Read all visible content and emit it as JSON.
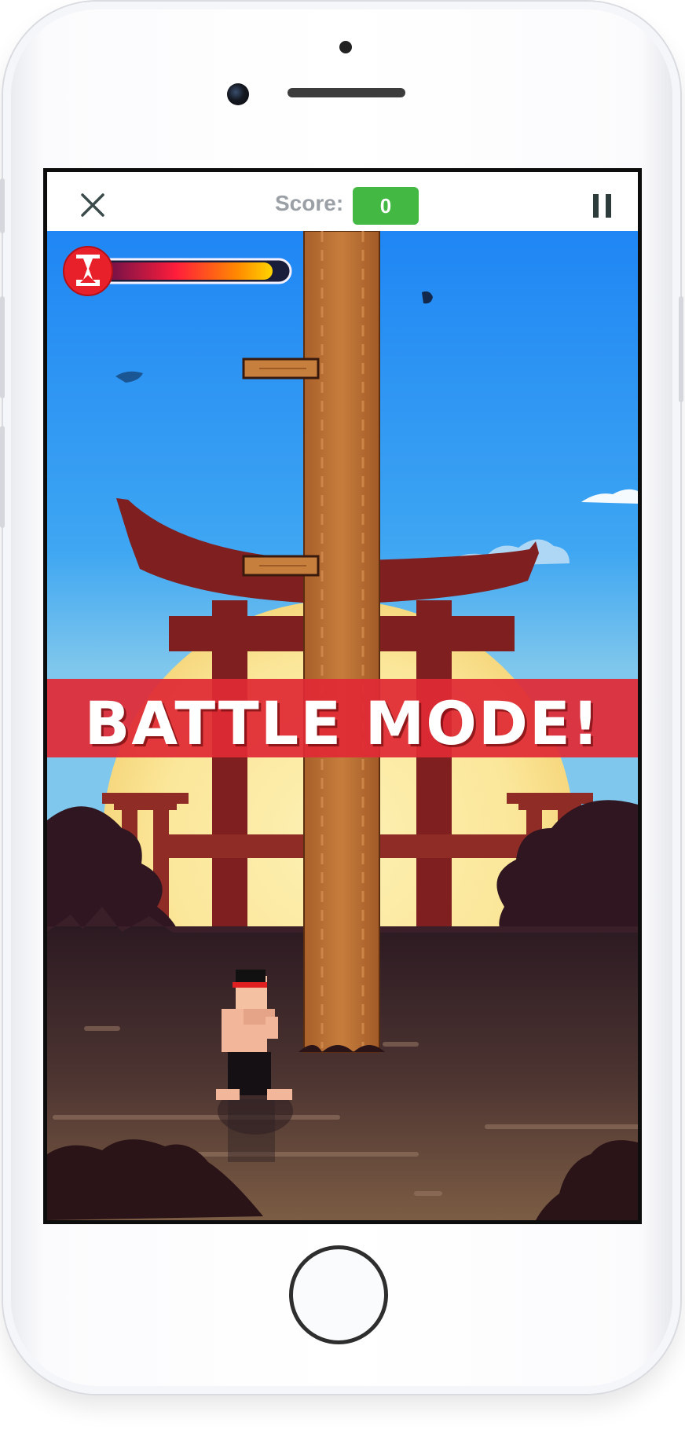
{
  "topbar": {
    "score_label": "Score:",
    "score_value": "0",
    "close_icon": "close-x",
    "pause_icon": "pause"
  },
  "game": {
    "banner_text": "BATTLE MODE!",
    "timer_icon": "hourglass",
    "timer_level": 0.92
  },
  "colors": {
    "score_badge": "#43b843",
    "banner": "#e02a35",
    "sky": "#2a8df0",
    "sun": "#fbe8a0",
    "gate": "#7f1f1f"
  }
}
